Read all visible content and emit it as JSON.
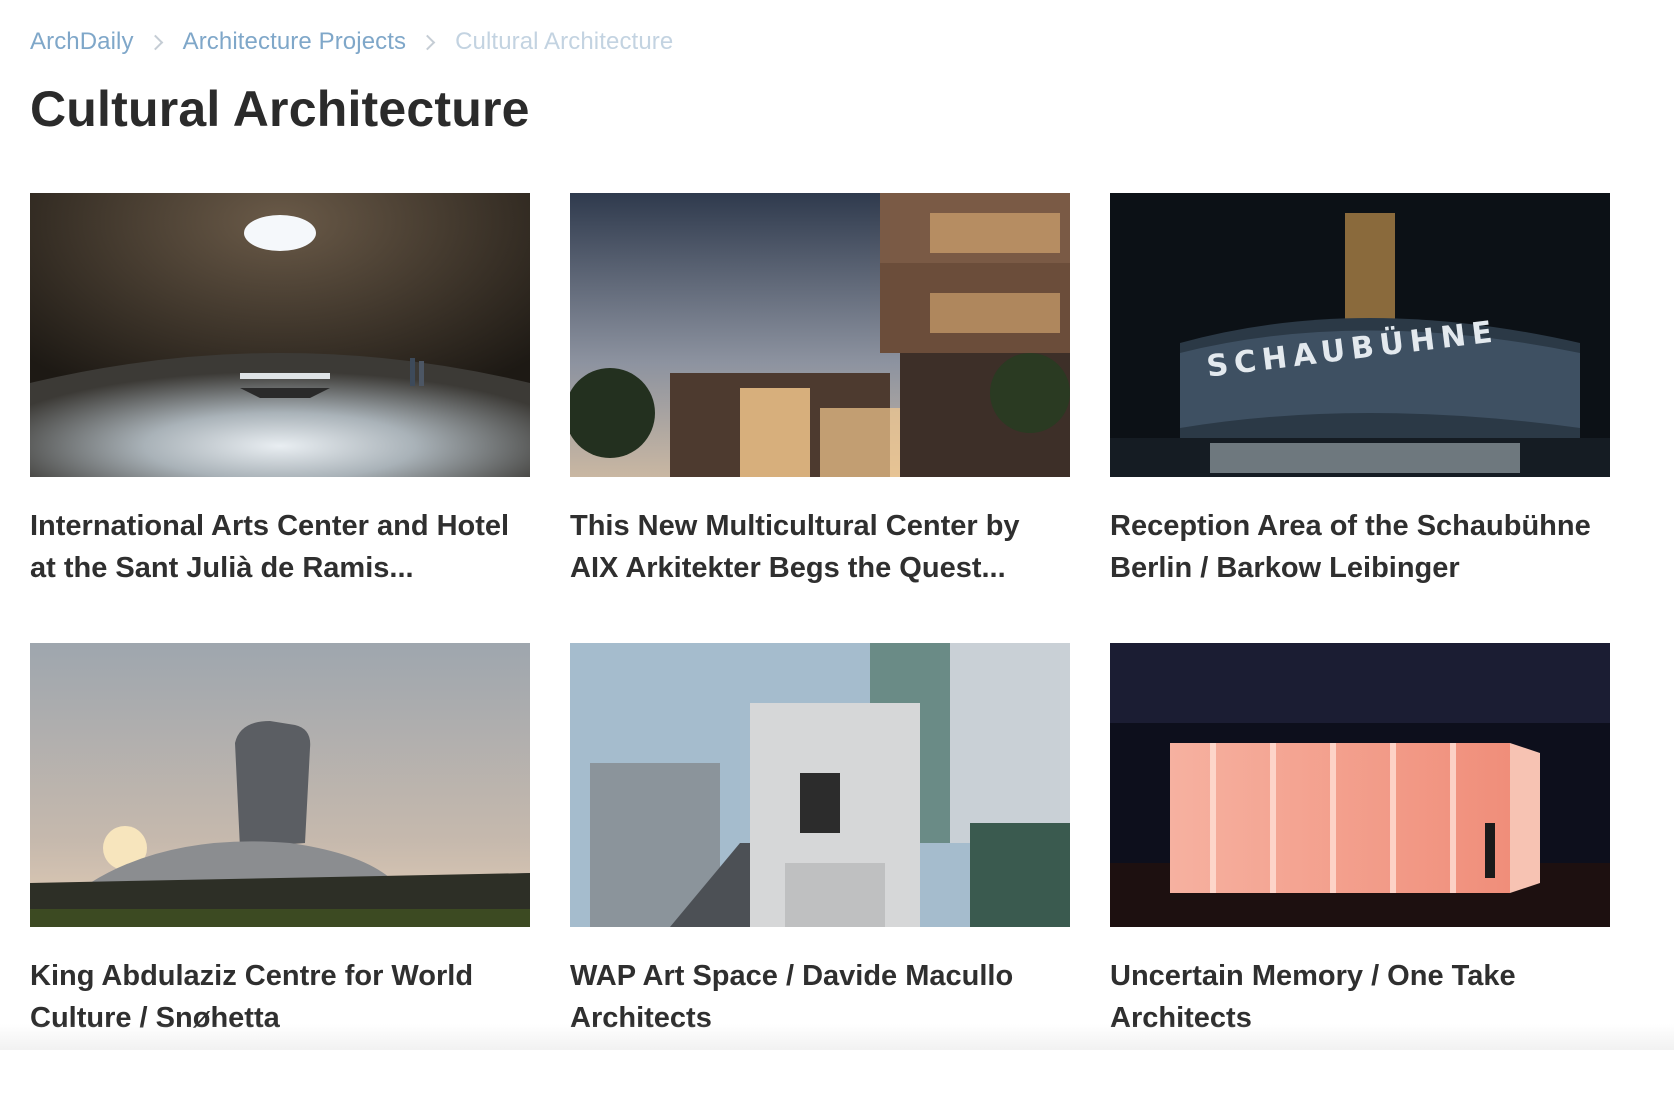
{
  "breadcrumb": {
    "items": [
      "ArchDaily",
      "Architecture Projects",
      "Cultural Architecture"
    ]
  },
  "page": {
    "title": "Cultural Architecture"
  },
  "cards": [
    {
      "title": "International Arts Center and Hotel at the Sant Julià de Ramis..."
    },
    {
      "title": "This New Multicultural Center by AIX Arkitekter Begs the Quest..."
    },
    {
      "title": "Reception Area of the Schaubühne Berlin / Barkow Leibinger"
    },
    {
      "title": "King Abdulaziz Centre for World Culture / Snøhetta"
    },
    {
      "title": "WAP Art Space / Davide Macullo Architects"
    },
    {
      "title": "Uncertain Memory / One Take Architects"
    }
  ],
  "images": {
    "schaubuhne_sign": "SCHAUBÜHNE"
  },
  "colors": {
    "breadcrumb_link": "#7fa7c9",
    "breadcrumb_current": "#c3d3e1",
    "title_text": "#2b2b2b"
  }
}
